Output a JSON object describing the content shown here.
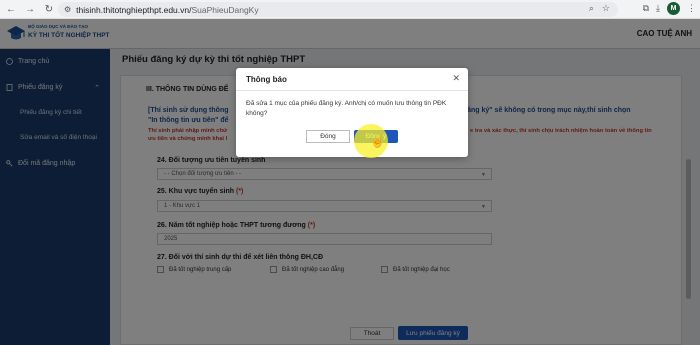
{
  "browser": {
    "url_host": "thisinh.thitotnghiepthpt.edu.vn/",
    "url_path": "SuaPhieuDangKy",
    "profile_initial": "M"
  },
  "header": {
    "logo_line1": "BỘ GIÁO DỤC VÀ ĐÀO TẠO",
    "logo_line2": "KỲ THI TỐT NGHIỆP THPT",
    "user_name": "CAO TUỆ ANH"
  },
  "sidebar": {
    "items": [
      {
        "label": "Trang chủ"
      },
      {
        "label": "Phiếu đăng ký"
      },
      {
        "label": "Phiếu đăng ký chi tiết"
      },
      {
        "label": "Sửa email và số điện thoại"
      },
      {
        "label": "Đổi mã đăng nhập"
      }
    ]
  },
  "page": {
    "title": "Phiếu đăng ký dự kỳ thi tốt nghiệp THPT",
    "section_title": "III. THÔNG TIN DÙNG ĐỂ",
    "note_blue_1": "[Thí sinh sử dụng thông",
    "note_blue_1_right": "n phiếu đăng ký\" sẽ không có trong mục này,thí sinh chọn",
    "note_blue_2": "\"In thông tin ưu tiên\" để",
    "note_red_1": "Thí sinh phải nhập minh chứ",
    "note_red_1_right": "e tra và xác thực, thí sinh chịu trách nhiệm hoàn toàn về thông tin",
    "note_red_2": "ưu tiên và chứng minh khai l",
    "field24_label": "24. Đối tượng ưu tiên tuyển sinh",
    "field24_value": "- - Chọn đối tượng ưu tiên - -",
    "field25_label": "25. Khu vực tuyển sinh",
    "field25_req": "(*)",
    "field25_value": "1 - Khu vực 1",
    "field26_label": "26. Năm tốt nghiệp hoặc THPT tương đương",
    "field26_req": "(*)",
    "field26_value": "2025",
    "field27_label": "27. Đối với thí sinh dự thi để xét liên thông ĐH,CĐ",
    "check1": "Đã tốt nghiệp trung cấp",
    "check2": "Đã tốt nghiệp cao đẳng",
    "check3": "Đã tốt nghiệp đại học",
    "btn_exit": "Thoát",
    "btn_save": "Lưu phiếu đăng ký"
  },
  "modal": {
    "title": "Thông báo",
    "body": "Đã sửa 1 mục của phiếu đăng ký. Anh/chị có muốn lưu thông tin PĐK không?",
    "btn_close": "Đóng",
    "btn_confirm": "Đồng ý"
  }
}
